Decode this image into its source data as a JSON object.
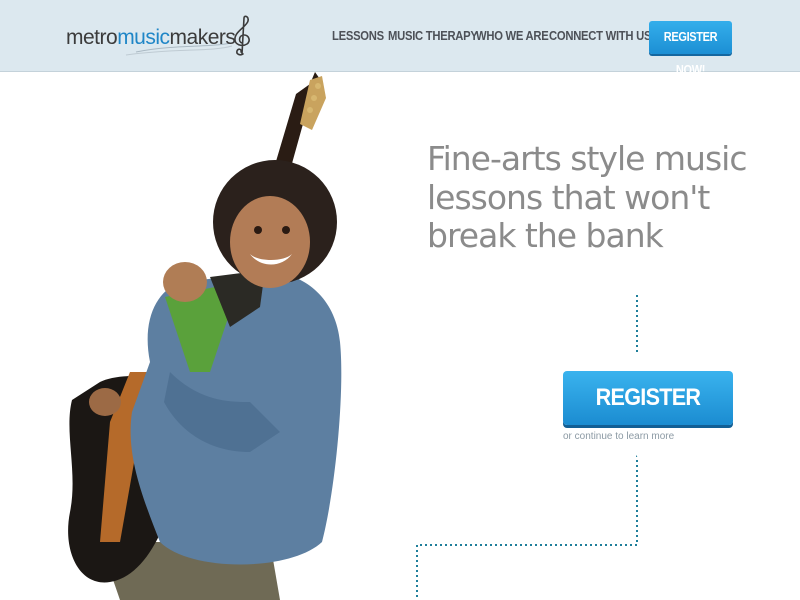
{
  "header": {
    "logo": {
      "part1": "metro",
      "part2": "music",
      "part3": "makers"
    },
    "nav": [
      {
        "label": "LESSONS"
      },
      {
        "label": "MUSIC THERAPY"
      },
      {
        "label": "WHO WE ARE"
      },
      {
        "label": "CONNECT WITH US"
      }
    ],
    "register_button": "REGISTER NOW!"
  },
  "hero": {
    "headline": "Fine-arts style music lessons that won't break the bank",
    "register_button": "REGISTER NOW!",
    "continue_text": "or continue to learn more"
  },
  "colors": {
    "header_bg": "#dce8ef",
    "accent": "#1f86c7",
    "button": "#2aa3e3",
    "headline": "#8b8b8b",
    "dots": "#1f7f9a"
  },
  "icons": [
    "treble-clef-icon"
  ]
}
